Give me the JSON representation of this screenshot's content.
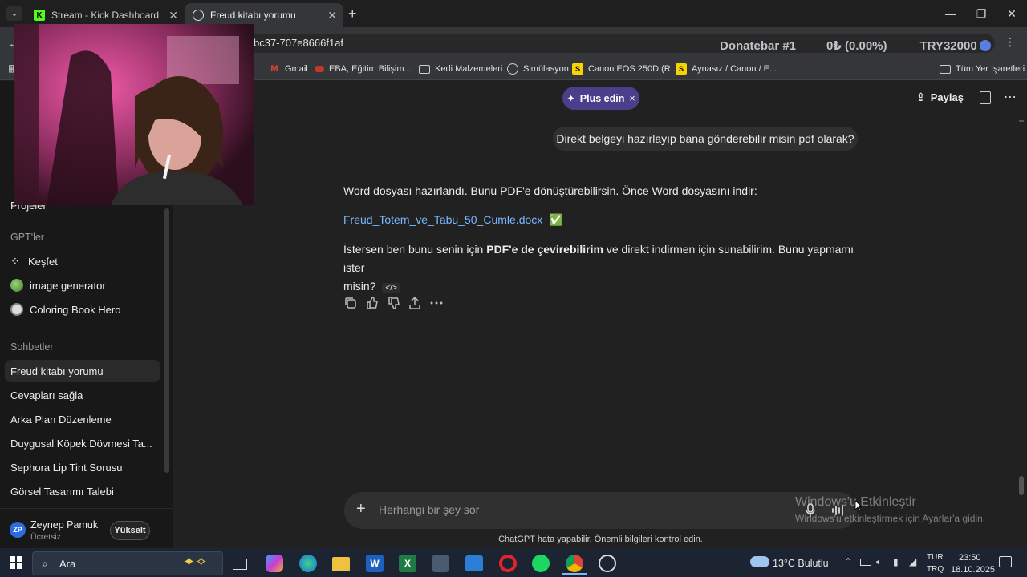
{
  "browser": {
    "tabs": [
      {
        "title": "Stream - Kick Dashboard",
        "icon": "kick-icon"
      },
      {
        "title": "Freud kitabı yorumu",
        "icon": "chatgpt-icon"
      }
    ],
    "url_fragment": "bc37-707e8666f1af",
    "bookmarks": [
      "Gmail",
      "EBA, Eğitim Bilişim...",
      "Kedi Malzemeleri",
      "Simülasyon",
      "Canon EOS 250D (R...",
      "Aynasız / Canon / E...",
      "Tüm Yer İşaretleri"
    ]
  },
  "overlay": {
    "donatebar": "Donatebar #1",
    "amount": "0₺ (0.00%)",
    "goal": "TRY32000"
  },
  "sidebar": {
    "partial_item": "Projeler",
    "gpts_header": "GPT'ler",
    "gpts": [
      "Keşfet",
      "image generator",
      "Coloring Book Hero"
    ],
    "chats_header": "Sohbetler",
    "chats": [
      "Freud kitabı yorumu",
      "Cevapları sağla",
      "Arka Plan Düzenleme",
      "Duygusal Köpek Dövmesi Ta...",
      "Sephora Lip Tint Sorusu",
      "Görsel Tasarımı Talebi"
    ],
    "user": {
      "initials": "ZP",
      "name": "Zeynep Pamuk",
      "plan": "Ücretsiz",
      "upgrade": "Yükselt"
    }
  },
  "header": {
    "plus_label": "Plus edin",
    "share_label": "Paylaş"
  },
  "conversation": {
    "user_message": "Direkt belgeyi hazırlayıp bana gönderebilir misin pdf olarak?",
    "assistant_line1": "Word dosyası hazırlandı. Bunu PDF'e dönüştürebilirsin. Önce Word dosyasını indir:",
    "file_link": "Freud_Totem_ve_Tabu_50_Cumle.docx",
    "check": "✅",
    "line3_a": "İstersen ben bunu senin için ",
    "line3_b": "PDF'e de çevirebilirim",
    "line3_c": " ve direkt indirmen için sunabilirim. Bunu yapmamı ister",
    "line3_d": "misin?",
    "code_glyph": "</>"
  },
  "composer": {
    "placeholder": "Herhangi bir şey sor",
    "disclaimer": "ChatGPT hata yapabilir. Önemli bilgileri kontrol edin."
  },
  "watermark": {
    "line1": "Windows'u Etkinleştir",
    "line2": "Windows'u etkinleştirmek için Ayarlar'a gidin."
  },
  "taskbar": {
    "search": "Ara",
    "weather": "13°C  Bulutlu",
    "lang1": "TUR",
    "lang2": "TRQ",
    "time": "23:50",
    "date": "18.10.2025"
  },
  "colors": {
    "accent_plus": "#4b3f8c",
    "link": "#7ab7ff",
    "chat_bg": "#212121"
  }
}
